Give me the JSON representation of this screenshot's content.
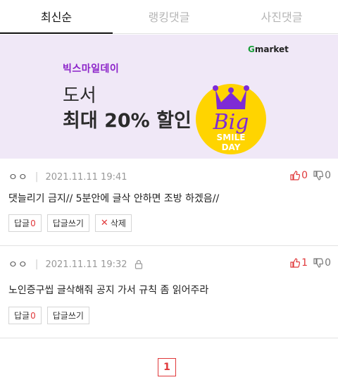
{
  "tabs": [
    {
      "label": "최신순",
      "active": true
    },
    {
      "label": "랭킹댓글",
      "active": false
    },
    {
      "label": "사진댓글",
      "active": false
    }
  ],
  "banner": {
    "brand_prefix": "G",
    "brand_suffix": "market",
    "kicker": "빅스마일데이",
    "title_line1": "도서",
    "title_line2": "최대 20% 할인",
    "badge_big": "Big",
    "badge_line1": "SMILE",
    "badge_line2": "DAY",
    "colors": {
      "background": "#f0e8f7",
      "kicker": "#8b22c9",
      "badge": "#ffd400",
      "crown": "#7e2bd6"
    }
  },
  "comments": [
    {
      "author": "ㅇㅇ",
      "date": "2021.11.11 19:41",
      "locked": false,
      "likes": "0",
      "dislikes": "0",
      "text": "댓늘리기 금지// 5분안에 글삭 안하면 조방 하겠음//",
      "reply_label": "답글",
      "reply_count": "0",
      "write_reply_label": "답글쓰기",
      "delete_label": "삭제"
    },
    {
      "author": "ㅇㅇ",
      "date": "2021.11.11 19:32",
      "locked": true,
      "likes": "1",
      "dislikes": "0",
      "text": "노인증구씹 글삭해줘 공지 가서 규칙 좀 읽어주라",
      "reply_label": "답글",
      "reply_count": "0",
      "write_reply_label": "답글쓰기"
    }
  ],
  "pagination": {
    "current_page": "1"
  },
  "icons": {
    "thumb_up": "thumbs-up-icon",
    "thumb_down": "thumbs-down-icon",
    "lock": "lock-icon",
    "delete": "close-icon"
  },
  "colors": {
    "accent": "#e0383a"
  }
}
